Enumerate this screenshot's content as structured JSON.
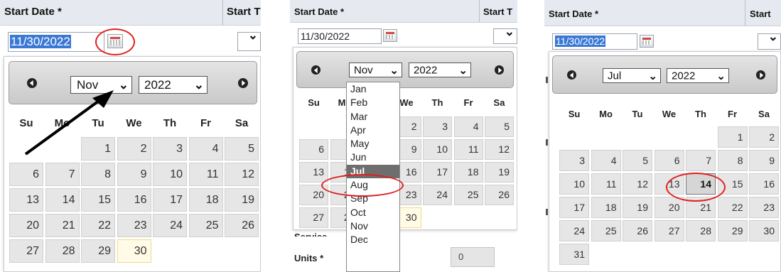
{
  "headers": {
    "start_date": "Start Date *",
    "start_time_p1": "Start T",
    "start_time_p2": "Start T",
    "start_time_p3": "Start"
  },
  "panels": [
    {
      "date_value": "11/30/2022",
      "month": "Nov",
      "year": "2022"
    },
    {
      "date_value": "11/30/2022",
      "month": "Nov",
      "year": "2022"
    },
    {
      "date_value": "11/30/2022",
      "month": "Jul",
      "year": "2022"
    }
  ],
  "weekdays": [
    "Su",
    "Mo",
    "Tu",
    "We",
    "Th",
    "Fr",
    "Sa"
  ],
  "nov_days": [
    "1",
    "2",
    "3",
    "4",
    "5",
    "6",
    "7",
    "8",
    "9",
    "10",
    "11",
    "12",
    "13",
    "14",
    "15",
    "16",
    "17",
    "18",
    "19",
    "20",
    "21",
    "22",
    "23",
    "24",
    "25",
    "26",
    "27",
    "28",
    "29",
    "30"
  ],
  "jul_days": [
    "1",
    "2",
    "3",
    "4",
    "5",
    "6",
    "7",
    "8",
    "9",
    "10",
    "11",
    "12",
    "13",
    "14",
    "15",
    "16",
    "17",
    "18",
    "19",
    "20",
    "21",
    "22",
    "23",
    "24",
    "25",
    "26",
    "27",
    "28",
    "29",
    "30",
    "31"
  ],
  "months": [
    "Jan",
    "Feb",
    "Mar",
    "Apr",
    "May",
    "Jun",
    "Jul",
    "Aug",
    "Sep",
    "Oct",
    "Nov",
    "Dec"
  ],
  "highlighted_month": "Jul",
  "background_labels": {
    "units": "Units *",
    "units_value": "0",
    "partial_label": "Service"
  },
  "colors": {
    "highlight_ring": "#e01f1f",
    "selection": "#3a78d6",
    "today_bg": "#fffbe6"
  }
}
